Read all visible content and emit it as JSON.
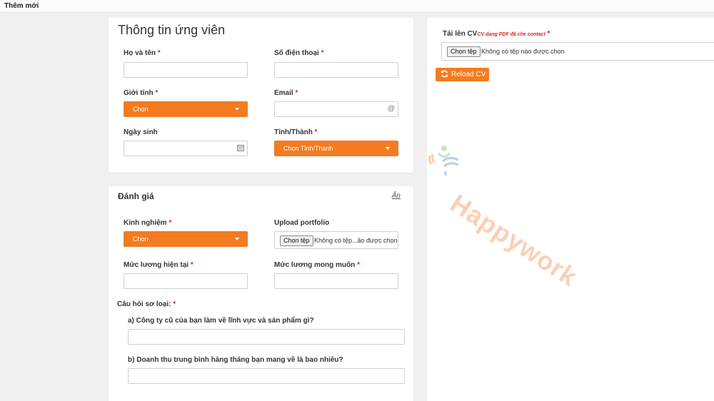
{
  "topbar": {
    "title": "Thêm mới"
  },
  "candidate": {
    "title": "Thông tin ứng viên",
    "name_label": "Họ và tên",
    "phone_label": "Số điện thoại",
    "gender_label": "Giới tính",
    "gender_value": "Chọn",
    "email_label": "Email",
    "email_icon": "@",
    "dob_label": "Ngày sinh",
    "province_label": "Tỉnh/Thành",
    "province_value": "Chọn Tỉnh/Thành",
    "required_mark": "*"
  },
  "evaluation": {
    "title": "Đánh giá",
    "hide_link": "Ẩn",
    "experience_label": "Kinh nghiệm",
    "experience_value": "Chọn",
    "portfolio_label": "Upload portfolio",
    "portfolio_button": "Chọn tệp",
    "portfolio_text": "Không có tệp...ảo được chọn",
    "current_salary_label": "Mức lương hiện tại",
    "expected_salary_label": "Mức lương mong muốn",
    "screening_label": "Câu hỏi sơ loại:",
    "question_a": "a) Công ty cũ của bạn làm về lĩnh vực và sản phẩm gì?",
    "question_b": "b) Doanh thu trung bình hàng tháng bạn mang về là bao nhiêu?"
  },
  "cv": {
    "label": "Tải lên CV",
    "hint": "CV dạng PDF đã che contact",
    "file_button": "Chọn tệp",
    "file_text": "Không có tệp nào được chọn",
    "reload_label": "Reload CV"
  },
  "watermark": {
    "text": "Happywork"
  },
  "colors": {
    "accent": "#f47b20",
    "required": "#e02020"
  },
  "icons": {
    "calendar": "calendar-icon",
    "at": "at-icon",
    "caret": "caret-down-icon",
    "refresh": "refresh-icon"
  }
}
